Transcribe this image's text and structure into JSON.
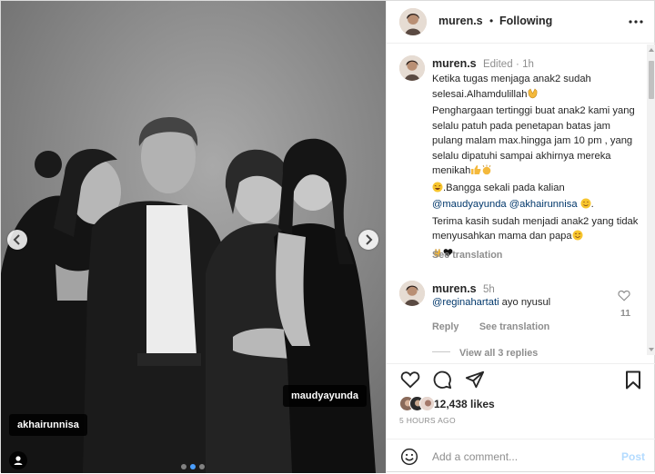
{
  "photo": {
    "tags": {
      "left": "akhairunnisa",
      "right": "maudyayunda"
    },
    "slides": {
      "count": 3,
      "active_index": 1
    },
    "prev_icon": "chevron-left-icon",
    "next_icon": "chevron-right-icon",
    "user_tag_icon": "person-icon"
  },
  "header": {
    "username": "muren.s",
    "separator": "•",
    "follow_status": "Following",
    "more_icon": "more-horizontal-icon"
  },
  "caption": {
    "username": "muren.s",
    "edited": "Edited",
    "dot": "·",
    "time": "1h",
    "line1": "Ketika tugas menjaga anak2 sudah selesai.Alhamdulillah",
    "line2": "Penghargaan tertinggi buat anak2 kami yang selalu patuh pada penetapan batas jam pulang malam max.hingga jam 10 pm , yang selalu dipatuhi sampai akhirnya mereka menikah",
    "line3": ".Bangga sekali pada kalian",
    "mention1": "@maudyayunda",
    "mention2": "@akhairunnisa",
    "line4": "Terima kasih sudah menjadi anak2 yang tidak menyusahkan mama dan papa",
    "see_translation": "See translation"
  },
  "comment": {
    "username": "muren.s",
    "time": "5h",
    "mention": "@reginahartati",
    "text": "ayo nyusul",
    "reply": "Reply",
    "see_translation": "See translation",
    "like_count": "11",
    "view_replies": "View all 3 replies"
  },
  "actions": {
    "likes": "12,438 likes",
    "time_ago": "5 HOURS AGO",
    "icons": [
      "heart-icon",
      "comment-icon",
      "share-icon",
      "bookmark-icon"
    ]
  },
  "add_comment": {
    "placeholder": "Add a comment...",
    "post": "Post",
    "emoji_icon": "emoji-icon"
  },
  "colors": {
    "link": "#00376b",
    "muted": "#8e8e8e",
    "post_disabled": "#b3dbff",
    "active_dot": "#4a9eff"
  }
}
